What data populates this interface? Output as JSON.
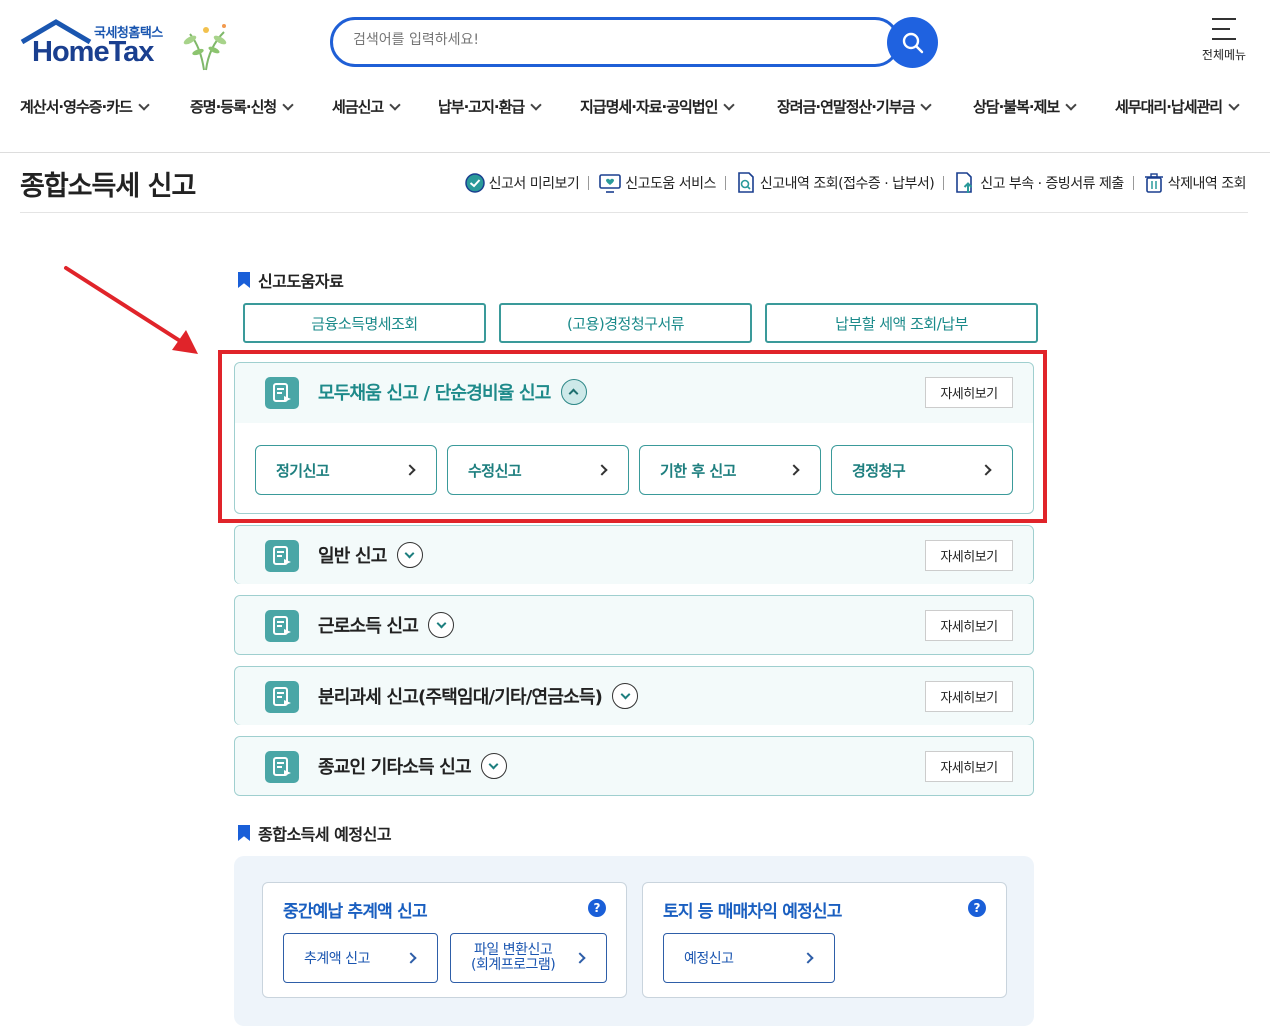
{
  "header": {
    "logo_small": "국세청홈택스",
    "logo_big": "HomeTax",
    "search_placeholder": "검색어를 입력하세요!",
    "all_menu_label": "전체메뉴"
  },
  "gnb": [
    "계산서·영수증·카드",
    "증명·등록·신청",
    "세금신고",
    "납부·고지·환급",
    "지급명세·자료·공익법인",
    "장려금·연말정산·기부금",
    "상담·불복·제보",
    "세무대리·납세관리"
  ],
  "page": {
    "title": "종합소득세 신고",
    "links": [
      {
        "label": "신고서 미리보기",
        "icon": "check-badge-icon"
      },
      {
        "label": "신고도움 서비스",
        "icon": "monitor-heart-icon"
      },
      {
        "label": "신고내역 조회(접수증 · 납부서)",
        "icon": "document-search-icon"
      },
      {
        "label": "신고 부속 · 증빙서류 제출",
        "icon": "upload-document-icon"
      },
      {
        "label": "삭제내역 조회",
        "icon": "trash-icon"
      }
    ]
  },
  "help": {
    "label": "신고도움자료",
    "buttons": [
      "금융소득명세조회",
      "(고용)경정청구서류",
      "납부할 세액 조회/납부"
    ]
  },
  "panels": [
    {
      "title": "모두채움 신고 / 단순경비율 신고",
      "detail": "자세히보기",
      "open": true,
      "buttons": [
        "정기신고",
        "수정신고",
        "기한 후 신고",
        "경정청구"
      ]
    },
    {
      "title": "일반 신고",
      "detail": "자세히보기",
      "open": false
    },
    {
      "title": "근로소득 신고",
      "detail": "자세히보기",
      "open": false
    },
    {
      "title": "분리과세 신고(주택임대/기타/연금소득)",
      "detail": "자세히보기",
      "open": false
    },
    {
      "title": "종교인 기타소득 신고",
      "detail": "자세히보기",
      "open": false
    }
  ],
  "estimate": {
    "label": "종합소득세 예정신고",
    "cards": [
      {
        "title": "중간예납 추계액 신고",
        "buttons": [
          "추계액 신고",
          "파일 변환신고",
          "(회계프로그램)"
        ]
      },
      {
        "title": "토지 등 매매차익 예정신고",
        "buttons": [
          "예정신고"
        ]
      }
    ]
  },
  "colors": {
    "accent_blue": "#1f62e0",
    "teal": "#3a9a9a",
    "annotation_red": "#e0242a"
  }
}
